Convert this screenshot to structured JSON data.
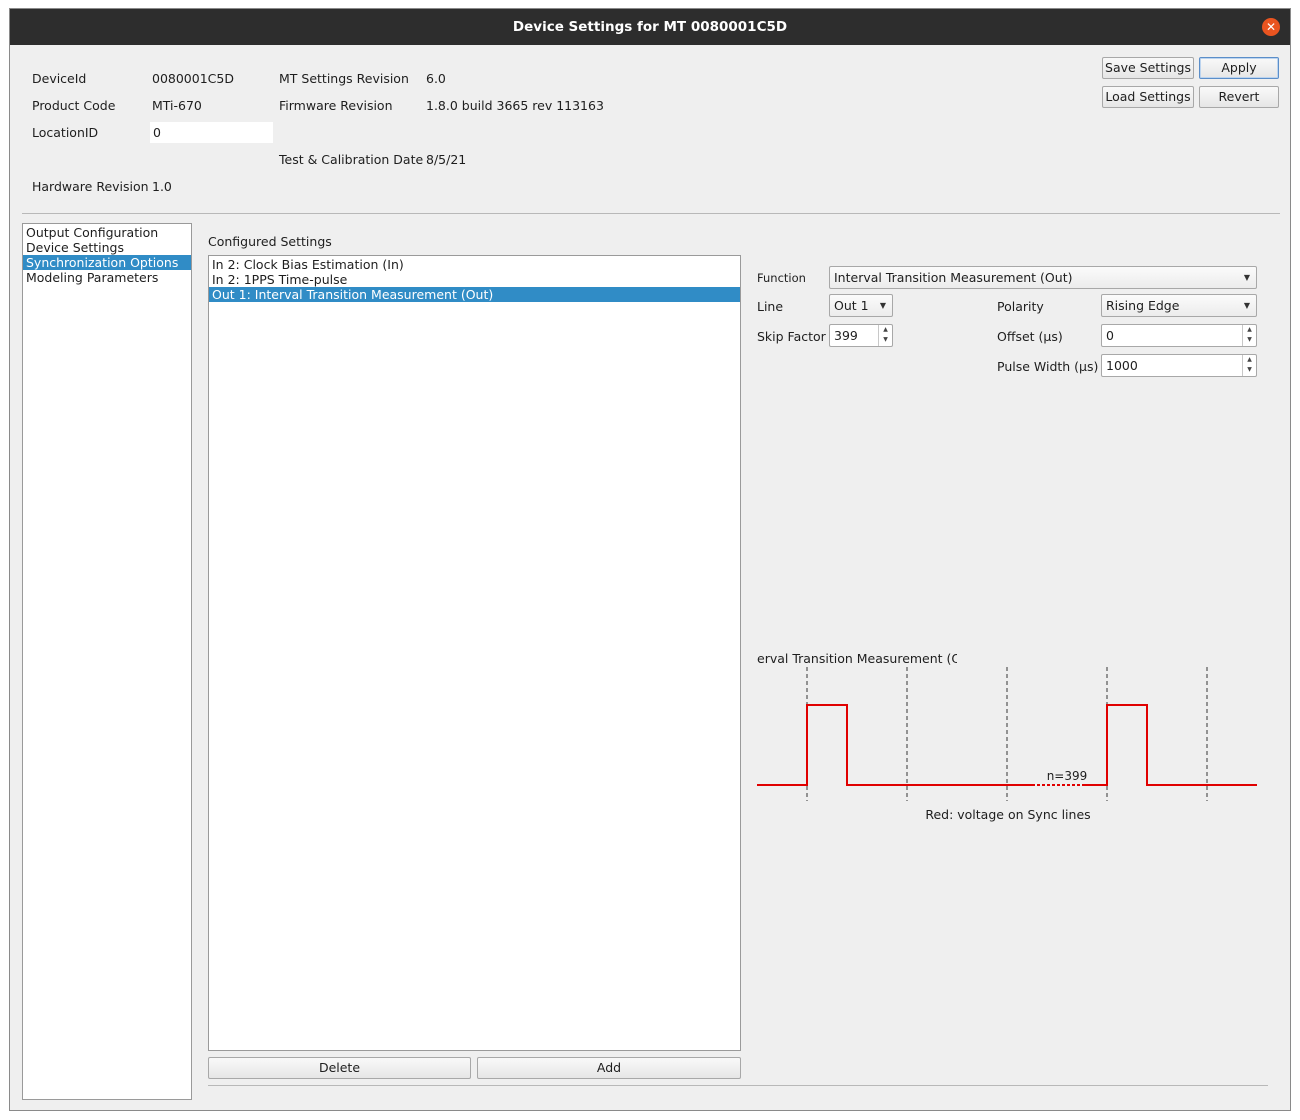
{
  "window": {
    "title": "Device Settings for MT 0080001C5D"
  },
  "info": {
    "device_id_label": "DeviceId",
    "device_id_value": "0080001C5D",
    "product_code_label": "Product Code",
    "product_code_value": "MTi-670",
    "location_id_label": "LocationID",
    "location_id_value": "0",
    "hardware_revision_label": "Hardware Revision",
    "hardware_revision_value": "1.0",
    "mt_settings_revision_label": "MT Settings Revision",
    "mt_settings_revision_value": "6.0",
    "firmware_revision_label": "Firmware Revision",
    "firmware_revision_value": "1.8.0 build 3665 rev 113163",
    "test_cal_date_label": "Test & Calibration Date",
    "test_cal_date_value": "8/5/21"
  },
  "actions": {
    "save_settings": "Save Settings",
    "apply": "Apply",
    "load_settings": "Load Settings",
    "revert": "Revert"
  },
  "nav": {
    "items": [
      "Output Configuration",
      "Device Settings",
      "Synchronization Options",
      "Modeling Parameters"
    ],
    "selected_index": 2
  },
  "configured": {
    "label": "Configured Settings",
    "items": [
      "In 2: Clock Bias Estimation (In)",
      "In 2: 1PPS Time-pulse",
      "Out 1: Interval Transition Measurement (Out)"
    ],
    "selected_index": 2,
    "delete_label": "Delete",
    "add_label": "Add"
  },
  "form": {
    "function_label": "Function",
    "function_value": "Interval Transition Measurement (Out)",
    "line_label": "Line",
    "line_value": "Out 1",
    "polarity_label": "Polarity",
    "polarity_value": "Rising Edge",
    "skip_factor_label": "Skip Factor",
    "skip_factor_value": "399",
    "offset_label": "Offset (µs)",
    "offset_value": "0",
    "pulse_width_label": "Pulse Width (µs)",
    "pulse_width_value": "1000"
  },
  "diagram": {
    "title": "erval Transition Measurement (Ou",
    "n_label": "n=399",
    "caption": "Red: voltage on Sync lines",
    "signal_color": "#e00000"
  }
}
